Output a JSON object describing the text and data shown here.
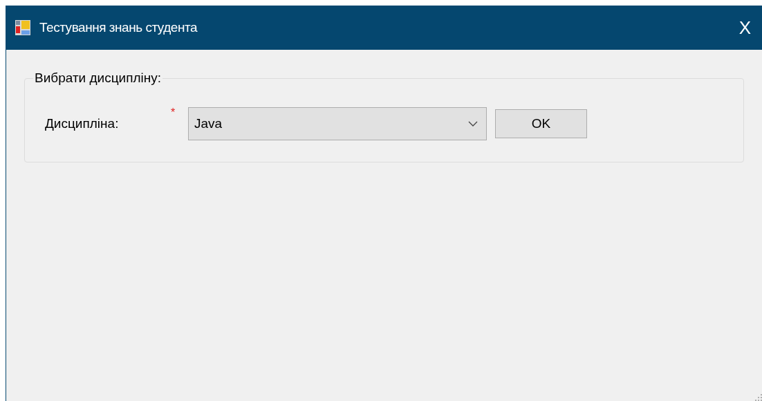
{
  "window": {
    "title": "Тестування знань студента",
    "close": "X"
  },
  "group": {
    "legend": "Вибрати дисципліну:",
    "field_label": "Дисципліна:",
    "required_mark": "*",
    "combo_value": "Java",
    "ok_button": "OK"
  }
}
